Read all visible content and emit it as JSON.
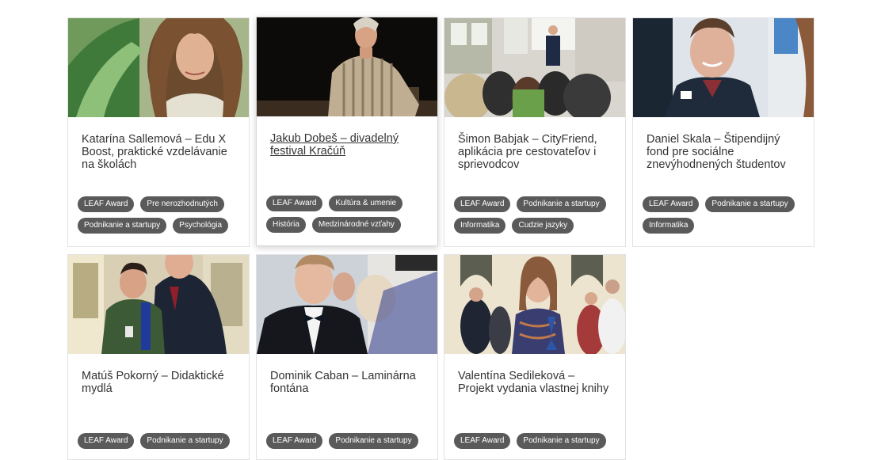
{
  "cards": [
    {
      "title": "Katarína Sallemová – Edu X Boost, praktické vzdelávanie na školách",
      "tags": [
        "LEAF Award",
        "Pre nerozhodnutých",
        "Podnikanie a startupy",
        "Psychológia"
      ],
      "image": "portrait of young woman with curly hair"
    },
    {
      "title": "Jakub Dobeš – divadelný festival Kračúň",
      "tags": [
        "LEAF Award",
        "Kultúra & umenie",
        "História",
        "Medzinárodné vzťahy"
      ],
      "image": "young actor in striped costume on dark stage"
    },
    {
      "title": "Šimon Babjak – CityFriend, aplikácia pre cestovateľov i sprievodcov",
      "tags": [
        "LEAF Award",
        "Podnikanie a startupy",
        "Informatika",
        "Cudzie jazyky"
      ],
      "image": "presenter in front of seated audience"
    },
    {
      "title": "Daniel Skala – Štipendijný fond pre sociálne znevýhodnených študentov",
      "tags": [
        "LEAF Award",
        "Podnikanie a startupy",
        "Informatika"
      ],
      "image": "smiling young man in dark jacket"
    },
    {
      "title": "Matúš Pokorný – Didaktické mydlá",
      "tags": [
        "LEAF Award",
        "Podnikanie a startupy"
      ],
      "image": "boy holding award next to man in suit"
    },
    {
      "title": "Dominik Caban – Laminárna fontána",
      "tags": [
        "LEAF Award",
        "Podnikanie a startupy"
      ],
      "image": "young man in tuxedo with bow tie"
    },
    {
      "title": "Valentína Sedileková – Projekt vydania vlastnej knihy",
      "tags": [
        "LEAF Award",
        "Podnikanie a startupy"
      ],
      "image": "young woman holding award at ceremony"
    }
  ]
}
